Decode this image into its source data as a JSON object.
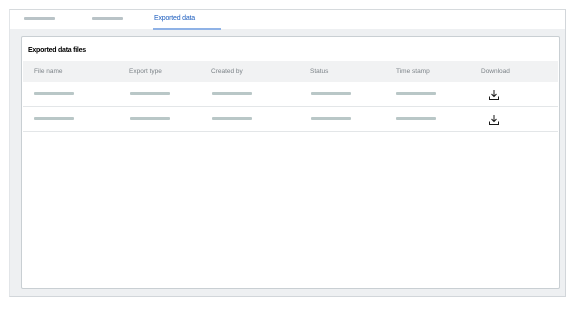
{
  "tabs": {
    "active_label": "Exported data"
  },
  "card": {
    "title": "Exported data files"
  },
  "table": {
    "columns": [
      "File name",
      "Export type",
      "Created by",
      "Status",
      "Time stamp",
      "Download"
    ],
    "rows": [
      {
        "download_icon": "download-icon"
      },
      {
        "download_icon": "download-icon"
      }
    ]
  },
  "colors": {
    "accent": "#1f5fbf",
    "active_tab_underline": "#8fb2e6",
    "placeholder_bar": "#b9c7c7",
    "background": "#eef0f2"
  }
}
